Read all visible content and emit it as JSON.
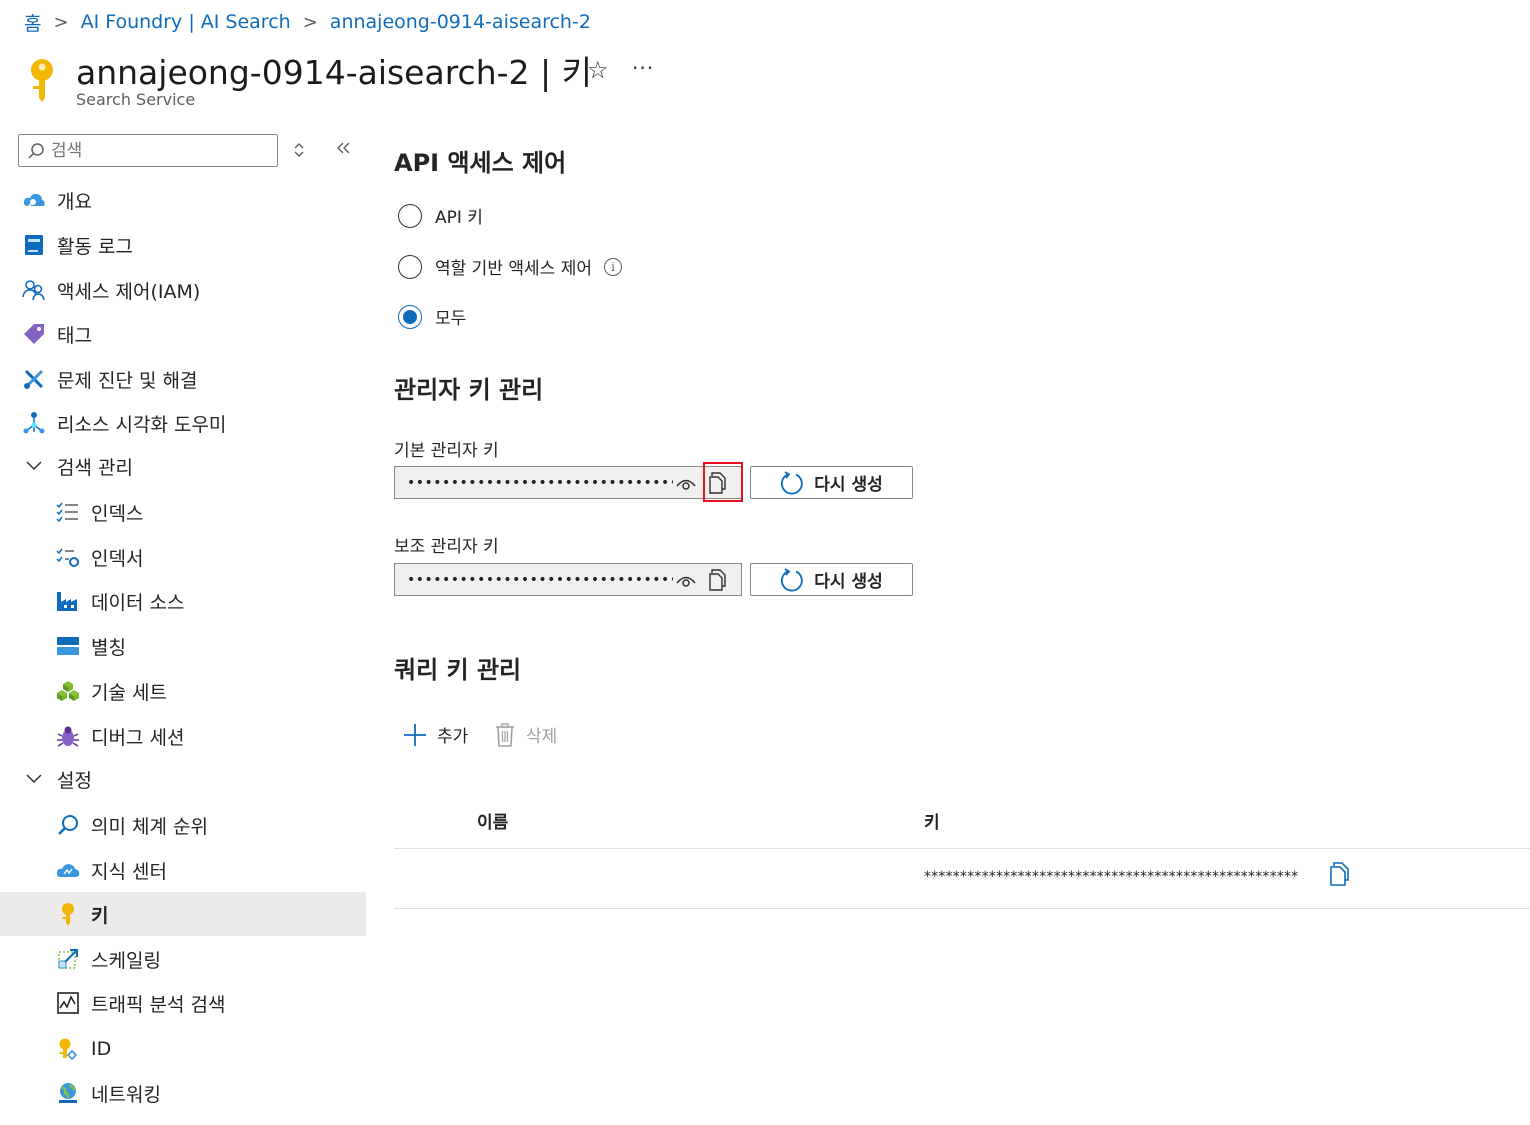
{
  "breadcrumb": {
    "home": "홈",
    "item1": "AI Foundry | AI Search",
    "item2": "annajeong-0914-aisearch-2"
  },
  "header": {
    "title": "annajeong-0914-aisearch-2 | 키",
    "subtitle": "Search Service",
    "more": "···",
    "star": "☆"
  },
  "sidebar": {
    "search_placeholder": "검색",
    "items": [
      {
        "label": "개요",
        "icon": "cloud-search-icon"
      },
      {
        "label": "활동 로그",
        "icon": "activity-log-icon"
      },
      {
        "label": "액세스 제어(IAM)",
        "icon": "people-icon"
      },
      {
        "label": "태그",
        "icon": "tag-icon"
      },
      {
        "label": "문제 진단 및 해결",
        "icon": "wrench-icon"
      },
      {
        "label": "리소스 시각화 도우미",
        "icon": "resource-visualizer-icon"
      }
    ],
    "group_search": {
      "label": "검색 관리",
      "items": [
        {
          "label": "인덱스",
          "icon": "index-list-icon"
        },
        {
          "label": "인덱서",
          "icon": "indexer-icon"
        },
        {
          "label": "데이터 소스",
          "icon": "factory-icon"
        },
        {
          "label": "별칭",
          "icon": "alias-icon"
        },
        {
          "label": "기술 세트",
          "icon": "cubes-icon"
        },
        {
          "label": "디버그 세션",
          "icon": "bug-icon"
        }
      ]
    },
    "group_settings": {
      "label": "설정",
      "items": [
        {
          "label": "의미 체계 순위",
          "icon": "search-icon"
        },
        {
          "label": "지식 센터",
          "icon": "cloud-icon"
        },
        {
          "label": "키",
          "icon": "key-icon",
          "active": true
        },
        {
          "label": "스케일링",
          "icon": "scale-icon"
        },
        {
          "label": "트래픽 분석 검색",
          "icon": "chart-icon"
        },
        {
          "label": "ID",
          "icon": "identity-key-icon"
        },
        {
          "label": "네트워킹",
          "icon": "globe-icon"
        }
      ]
    }
  },
  "main": {
    "api_access": {
      "heading": "API 액세스 제어",
      "options": [
        {
          "label": "API 키",
          "checked": false
        },
        {
          "label": "역할 기반 액세스 제어",
          "checked": false,
          "info": true
        },
        {
          "label": "모두",
          "checked": true
        }
      ]
    },
    "admin_keys": {
      "heading": "관리자 키 관리",
      "primary_label": "기본 관리자 키",
      "primary_value": "••••••••••••••••••••••••••••••••••••...",
      "secondary_label": "보조 관리자 키",
      "secondary_value": "••••••••••••••••••••••••••••••••••••...",
      "regenerate_label": "다시 생성"
    },
    "query_keys": {
      "heading": "쿼리 키 관리",
      "add_label": "추가",
      "delete_label": "삭제",
      "columns": [
        "이름",
        "키"
      ],
      "rows": [
        {
          "name": "",
          "key": "****************************************************"
        }
      ]
    }
  },
  "colors": {
    "accent": "#0f6cbd",
    "highlight_border": "#e81123",
    "active_bg": "#edebe9"
  }
}
